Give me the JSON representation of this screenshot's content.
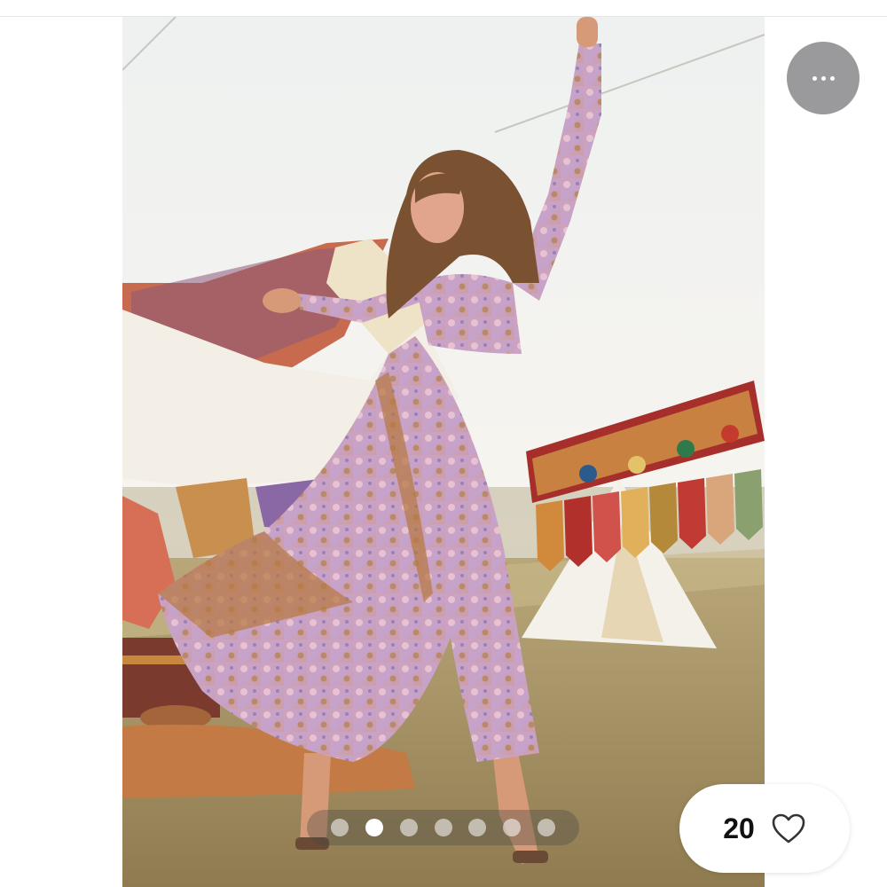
{
  "product_photo": {
    "image_label": "model-in-floral-maxi-dress",
    "slide_count": 7,
    "active_slide": 2
  },
  "more_menu": {
    "icon": "more-horizontal-icon"
  },
  "like": {
    "count": "20",
    "icon": "heart-outline-icon"
  },
  "colors": {
    "accent_gray": "#9a9a9c",
    "dress_lilac": "#c7a2c6",
    "dress_ochre": "#b57a3e"
  }
}
